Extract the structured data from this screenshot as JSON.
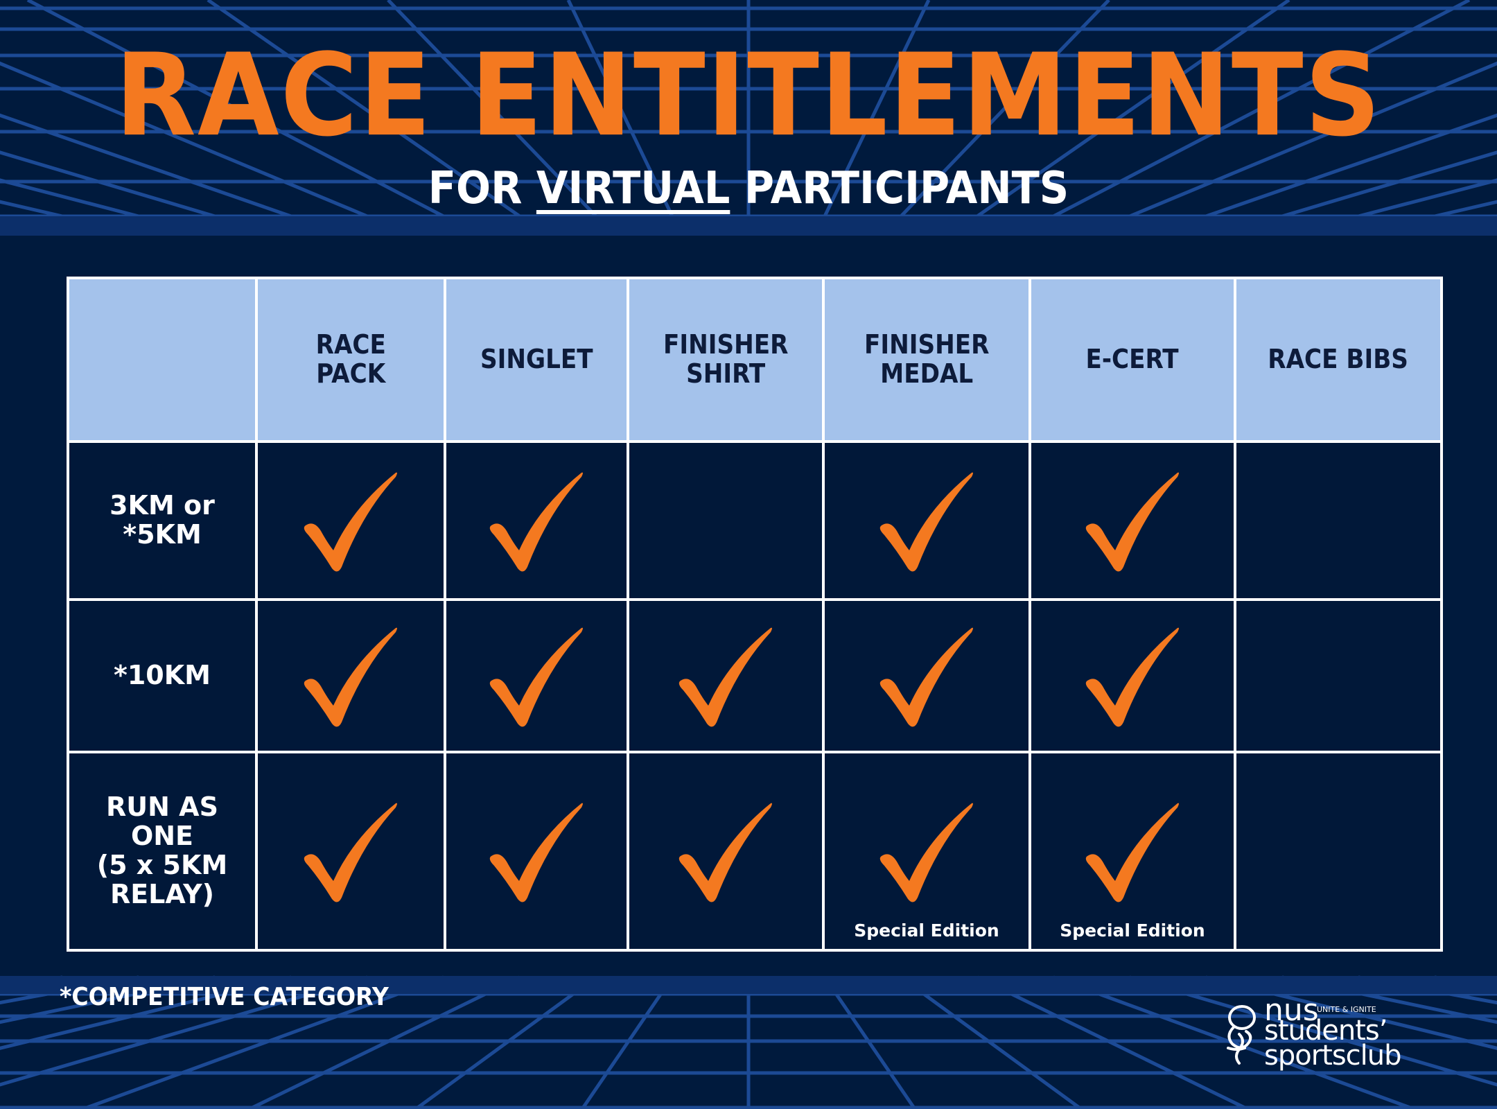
{
  "title": "RACE ENTITLEMENTS",
  "subtitle": {
    "before": "FOR ",
    "underlined": "VIRTUAL",
    "after": " PARTICIPANTS"
  },
  "columns": [
    "RACE\nPACK",
    "SINGLET",
    "FINISHER\nSHIRT",
    "FINISHER\nMEDAL",
    "E-CERT",
    "RACE BIBS"
  ],
  "rows": [
    {
      "label": "3KM or\n*5KM",
      "cells": [
        {
          "checked": true,
          "note": ""
        },
        {
          "checked": true,
          "note": ""
        },
        {
          "checked": false,
          "note": ""
        },
        {
          "checked": true,
          "note": ""
        },
        {
          "checked": true,
          "note": ""
        },
        {
          "checked": false,
          "note": ""
        }
      ]
    },
    {
      "label": "*10KM",
      "cells": [
        {
          "checked": true,
          "note": ""
        },
        {
          "checked": true,
          "note": ""
        },
        {
          "checked": true,
          "note": ""
        },
        {
          "checked": true,
          "note": ""
        },
        {
          "checked": true,
          "note": ""
        },
        {
          "checked": false,
          "note": ""
        }
      ]
    },
    {
      "label": "RUN AS\nONE\n(5 x 5KM\nRELAY)",
      "cells": [
        {
          "checked": true,
          "note": ""
        },
        {
          "checked": true,
          "note": ""
        },
        {
          "checked": true,
          "note": ""
        },
        {
          "checked": true,
          "note": "Special Edition"
        },
        {
          "checked": true,
          "note": "Special Edition"
        },
        {
          "checked": false,
          "note": ""
        }
      ]
    }
  ],
  "footnote": "*COMPETITIVE CATEGORY",
  "logo": {
    "nus": "nus",
    "tagline": "UNITE & IGNITE",
    "line1": "students’",
    "line2": "sportsclub"
  },
  "colors": {
    "background": "#001a3d",
    "accent": "#f47920",
    "header_bg": "#a4c2eb",
    "grid_line": "#1c4a95"
  }
}
